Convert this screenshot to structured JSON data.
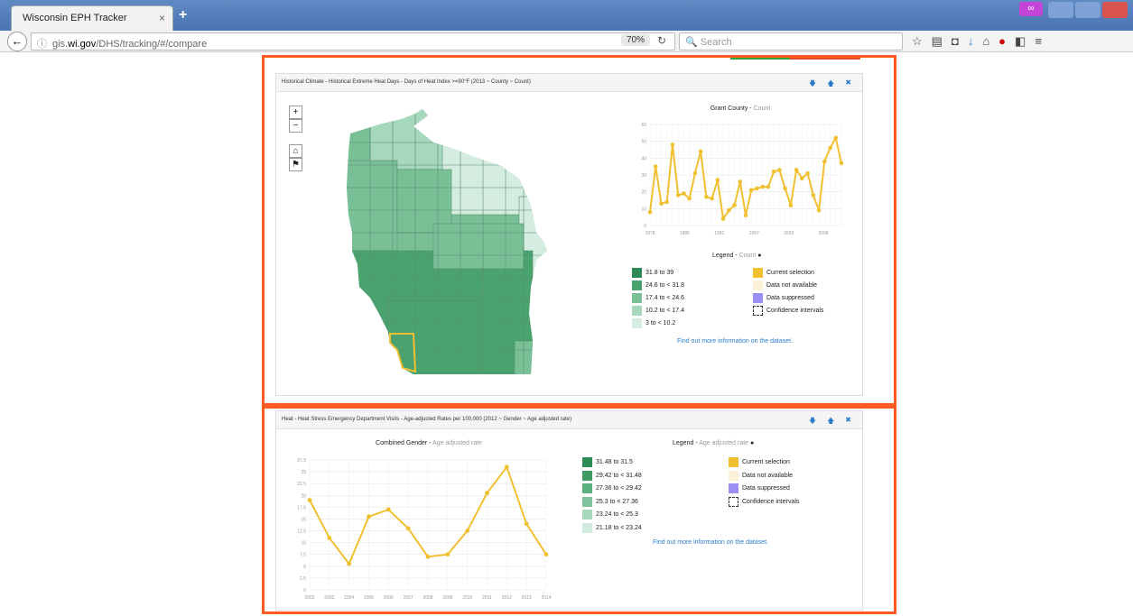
{
  "browser": {
    "tab_title": "Wisconsin EPH Tracker",
    "tab_close": "×",
    "new_tab": "+",
    "url_prefix": "gis.",
    "url_domain": "wi.gov",
    "url_path": "/DHS/tracking/#/compare",
    "zoom": "70%",
    "search_placeholder": "Search"
  },
  "panel1": {
    "title": "Historical Climate - Historical Extreme Heat Days - Days of Heat Index >=90°F (2013 ~ County ~ Count)",
    "map_controls": [
      "+",
      "−",
      "⌂",
      "⚑"
    ],
    "chart_title": "Grant County",
    "chart_subtitle": "Count",
    "legend_title": "Legend",
    "legend_subtitle": "Count",
    "legend_ranges": [
      {
        "label": "31.8 to 39",
        "color": "#2e8b57"
      },
      {
        "label": "24.6 to < 31.8",
        "color": "#4aa36e"
      },
      {
        "label": "17.4 to < 24.6",
        "color": "#79c097"
      },
      {
        "label": "10.2 to < 17.4",
        "color": "#a6d8bd"
      },
      {
        "label": "3 to < 10.2",
        "color": "#d4ede0"
      }
    ],
    "legend_other": [
      {
        "label": "Current selection",
        "color": "#f0c030"
      },
      {
        "label": "Data not available",
        "color": "#fdf0d8"
      },
      {
        "label": "Data suppressed",
        "color": "#9a8ff2"
      },
      {
        "label": "Confidence intervals",
        "color": "dashed"
      }
    ],
    "link": "Find out more information on the dataset."
  },
  "panel2": {
    "title": "Heat - Heat Stress Emergency Department Visits - Age-adjusted Rates per 100,000 (2012 ~ Gender ~ Age adjusted rate)",
    "chart_title": "Combined Gender",
    "chart_subtitle": "Age adjusted rate",
    "legend_title": "Legend",
    "legend_subtitle": "Age adjusted rate",
    "legend_ranges": [
      {
        "label": "31.48 to 31.5",
        "color": "#2e8b57"
      },
      {
        "label": "29.42 to < 31.48",
        "color": "#3f9a63"
      },
      {
        "label": "27.36 to < 29.42",
        "color": "#5bb07f"
      },
      {
        "label": "25.3 to < 27.36",
        "color": "#80c39c"
      },
      {
        "label": "23.24 to < 25.3",
        "color": "#a7d7bd"
      },
      {
        "label": "21.18 to < 23.24",
        "color": "#d1ebdf"
      }
    ],
    "legend_other": [
      {
        "label": "Current selection",
        "color": "#f0c030"
      },
      {
        "label": "Data not available",
        "color": "#fdf0d8"
      },
      {
        "label": "Data suppressed",
        "color": "#9a8ff2"
      },
      {
        "label": "Confidence intervals",
        "color": "dashed"
      }
    ],
    "link": "Find out more information on the dataset."
  },
  "colors": {
    "highlight_frame": "#ff5a22",
    "line": "#f0c030",
    "link": "#2a7cc9"
  },
  "chart_data": [
    {
      "type": "line",
      "title": "Grant County",
      "ylabel": "Count",
      "ylim": [
        0,
        60
      ],
      "yticks": [
        0,
        10,
        20,
        30,
        40,
        50,
        60
      ],
      "xticks": [
        "1878",
        "1885",
        "1991",
        "1997",
        "2003",
        "2008"
      ],
      "series": [
        {
          "name": "Grant County",
          "values": [
            8,
            35,
            13,
            14,
            48,
            18,
            19,
            16,
            31,
            44,
            17,
            16,
            27,
            4,
            9,
            12,
            26,
            6,
            21,
            22,
            23,
            23,
            32,
            33,
            22,
            12,
            33,
            28,
            31,
            18,
            9,
            38,
            46,
            52,
            37
          ]
        }
      ]
    },
    {
      "type": "line",
      "title": "Combined Gender",
      "ylabel": "Age adjusted rate",
      "ylim": [
        0,
        27.5
      ],
      "yticks": [
        0,
        2.5,
        5,
        7.5,
        10,
        12.5,
        15,
        17.5,
        20,
        22.5,
        25,
        27.5
      ],
      "categories": [
        "2002",
        "2003",
        "2004",
        "2005",
        "2006",
        "2007",
        "2008",
        "2009",
        "2010",
        "2011",
        "2012",
        "2013",
        "2014"
      ],
      "series": [
        {
          "name": "Combined Gender",
          "values": [
            19,
            11,
            5.5,
            15.5,
            17,
            13,
            7,
            7.5,
            12.5,
            20.5,
            26,
            14,
            7.5
          ]
        }
      ]
    }
  ]
}
